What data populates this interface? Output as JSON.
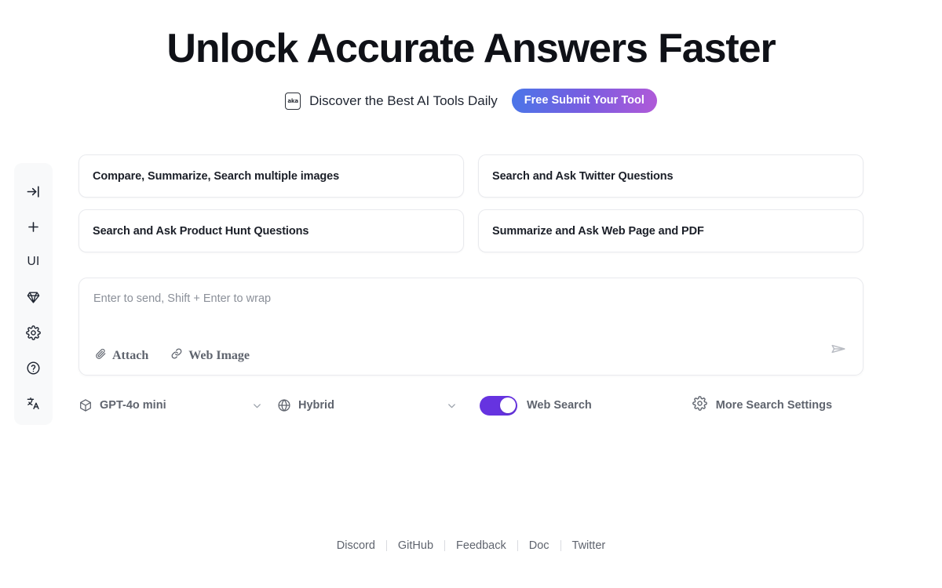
{
  "hero": {
    "title": "Unlock Accurate Answers Faster",
    "badge_icon_text": "aka",
    "subtitle": "Discover the Best AI Tools Daily",
    "submit_label": "Free Submit Your Tool"
  },
  "sidebar": {
    "items": [
      {
        "name": "collapse-sidebar",
        "icon": "arrow-to-line-icon",
        "label": ""
      },
      {
        "name": "new-chat",
        "icon": "plus-icon",
        "label": ""
      },
      {
        "name": "ui-mode",
        "icon": "ui-text-icon",
        "label": "UI"
      },
      {
        "name": "upgrade",
        "icon": "diamond-icon",
        "label": ""
      },
      {
        "name": "settings",
        "icon": "gear-icon",
        "label": ""
      },
      {
        "name": "help",
        "icon": "question-circle-icon",
        "label": ""
      },
      {
        "name": "language",
        "icon": "translate-icon",
        "label": ""
      }
    ]
  },
  "suggestions": [
    {
      "label": "Compare, Summarize, Search multiple images"
    },
    {
      "label": "Search and Ask Twitter Questions"
    },
    {
      "label": "Search and Ask Product Hunt Questions"
    },
    {
      "label": "Summarize and Ask Web Page and PDF"
    }
  ],
  "composer": {
    "placeholder": "Enter to send, Shift + Enter to wrap",
    "value": "",
    "attach_label": "Attach",
    "web_image_label": "Web Image",
    "send_label": "Send"
  },
  "controls": {
    "model": "GPT-4o mini",
    "search_mode": "Hybrid",
    "web_search_label": "Web Search",
    "web_search_on": true,
    "more_settings_label": "More Search Settings"
  },
  "footer": {
    "links": [
      "Discord",
      "GitHub",
      "Feedback",
      "Doc",
      "Twitter"
    ]
  },
  "colors": {
    "accent_purple": "#6633e0",
    "gradient_start": "#4a76e8",
    "gradient_end": "#b05ad8",
    "text_primary": "#0f1117",
    "text_muted": "#5f646e",
    "border": "#e9eaee",
    "sidebar_bg": "#f8f9fa"
  }
}
